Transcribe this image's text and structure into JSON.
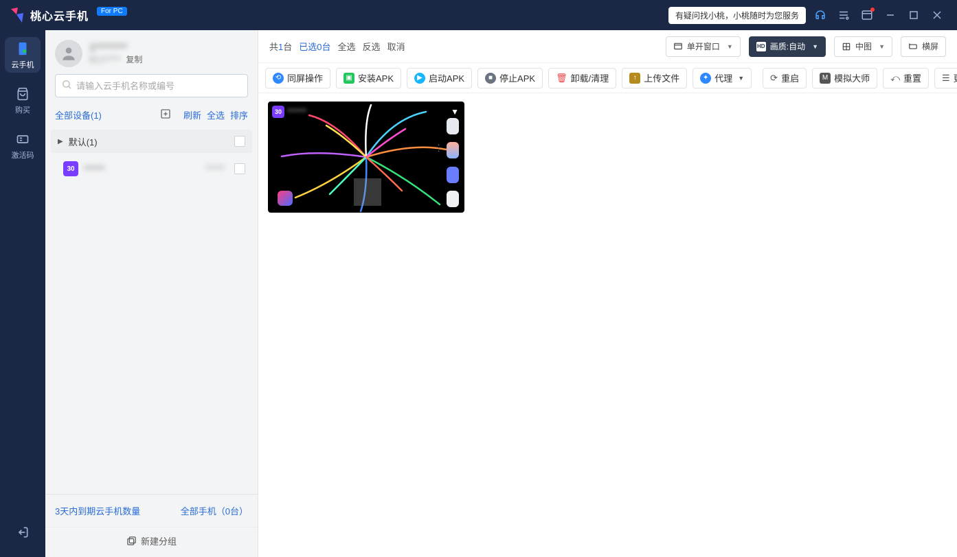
{
  "titlebar": {
    "product_name": "桃心云手机",
    "pc_badge": "For PC",
    "help_text": "有疑问找小桃，小桃随时为您服务"
  },
  "rail": {
    "items": [
      {
        "key": "cloud-phone",
        "label": "云手机",
        "active": true
      },
      {
        "key": "buy",
        "label": "购买",
        "active": false
      },
      {
        "key": "activation",
        "label": "激活码",
        "active": false
      }
    ]
  },
  "user": {
    "display_name": "1********",
    "id_text": "ID:1*****",
    "copy_label": "复制"
  },
  "search": {
    "placeholder": "请输入云手机名称或编号"
  },
  "device_header": {
    "all_label": "全部设备(1)",
    "refresh": "刷新",
    "select_all": "全选",
    "sort": "排序"
  },
  "groups": [
    {
      "name": "默认(1)",
      "expanded": true
    }
  ],
  "devices": [
    {
      "badge": "30",
      "name": "******",
      "status": "******"
    }
  ],
  "side_footer": {
    "expiring_label": "3天内到期云手机数量",
    "all_phones_label": "全部手机（0台）",
    "new_group_label": "新建分组"
  },
  "top_strip": {
    "total_prefix": "共",
    "total_count": "1",
    "total_suffix": "台",
    "selected_prefix": "已选",
    "selected_count": "0",
    "selected_suffix": "台",
    "select_all": "全选",
    "invert": "反选",
    "cancel": "取消",
    "window_mode": "单开窗口",
    "quality": "画质:自动",
    "thumb_size": "中图",
    "orientation": "横屏"
  },
  "toolbar": {
    "sync_op": "同屏操作",
    "install_apk": "安装APK",
    "launch_apk": "启动APK",
    "stop_apk": "停止APK",
    "uninstall": "卸载/清理",
    "upload_file": "上传文件",
    "proxy": "代理",
    "restart": "重启",
    "sim_master": "模拟大师",
    "reset": "重置",
    "more_ops": "更多操作"
  },
  "card": {
    "badge": "30",
    "name": "******"
  }
}
